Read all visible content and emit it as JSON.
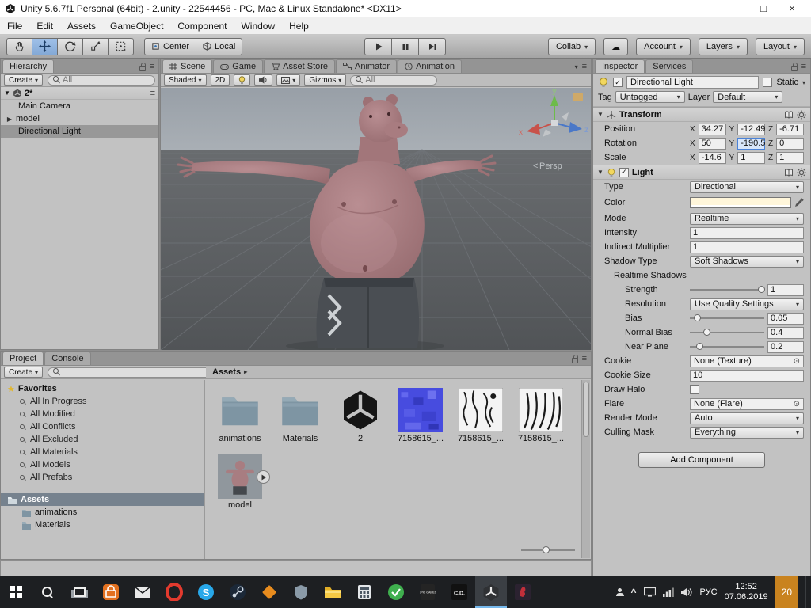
{
  "icons": {
    "dropdown": "▾",
    "menu": "≡",
    "check": "✓",
    "picker": "⊙",
    "cloud": "☁",
    "star": "★",
    "caret_up": "^",
    "breadcrumb_arrow": "▸",
    "fold_open": "▼",
    "fold_closed": "▶"
  },
  "window": {
    "title": "Unity 5.6.7f1 Personal (64bit) - 2.unity - 22544456 - PC, Mac & Linux Standalone* <DX11>",
    "minimize": "—",
    "maximize": "□",
    "close": "×"
  },
  "menu": {
    "items": [
      "File",
      "Edit",
      "Assets",
      "GameObject",
      "Component",
      "Window",
      "Help"
    ]
  },
  "toolbar": {
    "center": "Center",
    "local": "Local",
    "collab": "Collab",
    "account": "Account",
    "layers": "Layers",
    "layout": "Layout"
  },
  "hierarchy": {
    "tab": "Hierarchy",
    "create": "Create",
    "search_hint": "All",
    "scene_name": "2*",
    "items": [
      "Main Camera",
      "model",
      "Directional Light"
    ]
  },
  "scene_view": {
    "tabs": [
      "Scene",
      "Game",
      "Asset Store",
      "Animator",
      "Animation"
    ],
    "shaded": "Shaded",
    "two_d": "2D",
    "gizmos": "Gizmos",
    "search_hint": "All",
    "persp_toggle": "<",
    "persp": "Persp",
    "axes": {
      "x": "x",
      "y": "y",
      "z": "z"
    }
  },
  "project": {
    "tab": "Project",
    "console_tab": "Console",
    "create": "Create",
    "favorites_title": "Favorites",
    "favorites": [
      "All In Progress",
      "All Modified",
      "All Conflicts",
      "All Excluded",
      "All Materials",
      "All Models",
      "All Prefabs"
    ],
    "root": "Assets",
    "folders": [
      "animations",
      "Materials"
    ],
    "breadcrumb": "Assets",
    "assets": [
      {
        "label": "animations"
      },
      {
        "label": "Materials"
      },
      {
        "label": "2"
      },
      {
        "label": "7158615_..."
      },
      {
        "label": "7158615_..."
      },
      {
        "label": "7158615_..."
      },
      {
        "label": "model"
      }
    ]
  },
  "inspector": {
    "tab": "Inspector",
    "services_tab": "Services",
    "name": "Directional Light",
    "static_label": "Static",
    "tag_label": "Tag",
    "tag_value": "Untagged",
    "layer_label": "Layer",
    "layer_value": "Default",
    "axis": {
      "x": "X",
      "y": "Y",
      "z": "Z"
    },
    "transform": {
      "title": "Transform",
      "position": {
        "label": "Position",
        "x": "34.27",
        "y": "-12.49",
        "z": "-6.71"
      },
      "rotation": {
        "label": "Rotation",
        "x": "50",
        "y": "-190.5",
        "z": "0"
      },
      "scale": {
        "label": "Scale",
        "x": "-14.6",
        "y": "1",
        "z": "1"
      }
    },
    "light": {
      "title": "Light",
      "type_label": "Type",
      "type_value": "Directional",
      "color_label": "Color",
      "color_value": "#FFF4D6",
      "mode_label": "Mode",
      "mode_value": "Realtime",
      "intensity_label": "Intensity",
      "intensity_value": "1",
      "indirect_label": "Indirect Multiplier",
      "indirect_value": "1",
      "shadow_type_label": "Shadow Type",
      "shadow_type_value": "Soft Shadows",
      "realtime_shadows_label": "Realtime Shadows",
      "strength_label": "Strength",
      "strength_value": "1",
      "resolution_label": "Resolution",
      "resolution_value": "Use Quality Settings",
      "bias_label": "Bias",
      "bias_value": "0.05",
      "normal_bias_label": "Normal Bias",
      "normal_bias_value": "0.4",
      "near_plane_label": "Near Plane",
      "near_plane_value": "0.2",
      "cookie_label": "Cookie",
      "cookie_value": "None (Texture)",
      "cookie_size_label": "Cookie Size",
      "cookie_size_value": "10",
      "draw_halo_label": "Draw Halo",
      "flare_label": "Flare",
      "flare_value": "None (Flare)",
      "render_mode_label": "Render Mode",
      "render_mode_value": "Auto",
      "culling_mask_label": "Culling Mask",
      "culling_mask_value": "Everything"
    },
    "add_component": "Add Component"
  },
  "taskbar": {
    "skype_letter": "S",
    "epic_label": "EPIC GAMES",
    "cd_label": "C.D.",
    "lang": "РУС",
    "time": "12:52",
    "date": "07.06.2019",
    "badge": "20"
  }
}
